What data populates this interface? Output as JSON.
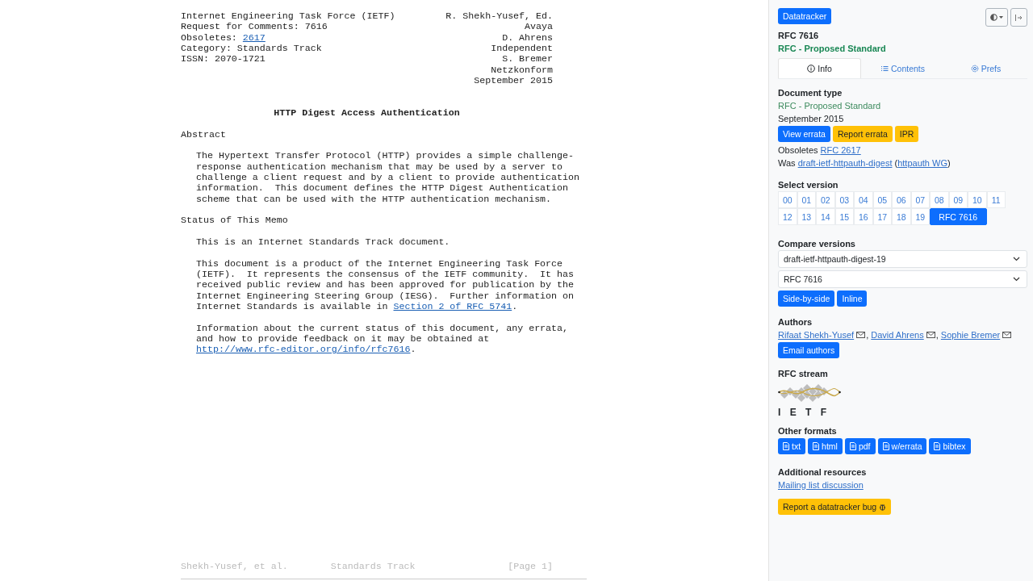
{
  "document": {
    "header": [
      {
        "left": [
          "Internet Engineering Task Force (IETF)"
        ],
        "right": "R. Shekh-Yusef, Ed."
      },
      {
        "left": [
          "Request for Comments: 7616"
        ],
        "right": "Avaya"
      },
      {
        "left": [
          "Obsoletes: ",
          {
            "text": "2617",
            "link": true
          }
        ],
        "right": "D. Ahrens"
      },
      {
        "left": [
          "Category: Standards Track"
        ],
        "right": "Independent"
      },
      {
        "left": [
          "ISSN: 2070-1721"
        ],
        "right": "S. Bremer"
      },
      {
        "right": "Netzkonform"
      },
      {
        "right": "September 2015"
      }
    ],
    "title": "HTTP Digest Access Authentication",
    "blocks": [
      {
        "kind": "heading",
        "lines": [
          [
            "Abstract"
          ]
        ]
      },
      {
        "kind": "para",
        "lines": [
          [
            "The Hypertext Transfer Protocol (HTTP) provides a simple challenge-"
          ],
          [
            "response authentication mechanism that may be used by a server to"
          ],
          [
            "challenge a client request and by a client to provide authentication"
          ],
          [
            "information.  This document defines the HTTP Digest Authentication"
          ],
          [
            "scheme that can be used with the HTTP authentication mechanism."
          ]
        ]
      },
      {
        "kind": "heading",
        "lines": [
          [
            "Status of This Memo"
          ]
        ]
      },
      {
        "kind": "para",
        "lines": [
          [
            "This is an Internet Standards Track document."
          ]
        ]
      },
      {
        "kind": "para",
        "lines": [
          [
            "This document is a product of the Internet Engineering Task Force"
          ],
          [
            "(IETF).  It represents the consensus of the IETF community.  It has"
          ],
          [
            "received public review and has been approved for publication by the"
          ],
          [
            "Internet Engineering Steering Group (IESG).  Further information on"
          ],
          [
            "Internet Standards is available in ",
            {
              "text": "Section 2 of RFC 5741",
              "link": true
            },
            "."
          ]
        ]
      },
      {
        "kind": "para",
        "lines": [
          [
            "Information about the current status of this document, any errata,"
          ],
          [
            "and how to provide feedback on it may be obtained at"
          ],
          [
            {
              "text": "http://www.rfc-editor.org/info/rfc7616",
              "link": true
            },
            "."
          ]
        ]
      }
    ],
    "footer": [
      "Shekh-Yusef, et al.",
      "Standards Track",
      "[Page 1]"
    ]
  },
  "sidebar": {
    "app_button": "Datatracker",
    "doc_name": "RFC 7616",
    "doc_status": "RFC - Proposed Standard",
    "tabs": [
      {
        "label": "Info",
        "selected": true
      },
      {
        "label": "Contents",
        "selected": false
      },
      {
        "label": "Prefs",
        "selected": false
      }
    ],
    "document_type": {
      "heading": "Document type",
      "status": "RFC - Proposed Standard",
      "date": "September 2015",
      "buttons": [
        {
          "label": "View errata",
          "kind": "primary"
        },
        {
          "label": "Report errata",
          "kind": "warning"
        },
        {
          "label": "IPR",
          "kind": "warning"
        }
      ],
      "lines": [
        [
          "Obsoletes ",
          {
            "text": "RFC 2617",
            "link": true
          }
        ],
        [
          "Was ",
          {
            "text": "draft-ietf-httpauth-digest",
            "link": true
          },
          " (",
          {
            "text": "httpauth WG",
            "link": true
          },
          ")"
        ]
      ]
    },
    "select_version": {
      "heading": "Select version",
      "versions": [
        {
          "label": "00",
          "selected": false
        },
        {
          "label": "01",
          "selected": false
        },
        {
          "label": "02",
          "selected": false
        },
        {
          "label": "03",
          "selected": false
        },
        {
          "label": "04",
          "selected": false
        },
        {
          "label": "05",
          "selected": false
        },
        {
          "label": "06",
          "selected": false
        },
        {
          "label": "07",
          "selected": false
        },
        {
          "label": "08",
          "selected": false
        },
        {
          "label": "09",
          "selected": false
        },
        {
          "label": "10",
          "selected": false
        },
        {
          "label": "11",
          "selected": false
        },
        {
          "label": "12",
          "selected": false
        },
        {
          "label": "13",
          "selected": false
        },
        {
          "label": "14",
          "selected": false
        },
        {
          "label": "15",
          "selected": false
        },
        {
          "label": "16",
          "selected": false
        },
        {
          "label": "17",
          "selected": false
        },
        {
          "label": "18",
          "selected": false
        },
        {
          "label": "19",
          "selected": false
        },
        {
          "label": "RFC 7616",
          "selected": true
        }
      ]
    },
    "compare_versions": {
      "heading": "Compare versions",
      "selects": [
        {
          "value": "draft-ietf-httpauth-digest-19"
        },
        {
          "value": "RFC 7616"
        }
      ],
      "buttons": [
        "Side-by-side",
        "Inline"
      ]
    },
    "authors": {
      "heading": "Authors",
      "people": [
        {
          "name": "Rifaat Shekh-Yusef",
          "after": ","
        },
        {
          "name": "David Ahrens",
          "after": ","
        },
        {
          "name": "Sophie Bremer"
        }
      ],
      "button": "Email authors"
    },
    "rfc_stream": {
      "heading": "RFC stream",
      "logo_text": "I E T F"
    },
    "other_formats": {
      "heading": "Other formats",
      "buttons": [
        "txt",
        "html",
        "pdf",
        "w/errata",
        "bibtex"
      ]
    },
    "additional_resources": {
      "heading": "Additional resources",
      "links": [
        "Mailing list discussion"
      ]
    },
    "bug_button": "Report a datatracker bug"
  }
}
